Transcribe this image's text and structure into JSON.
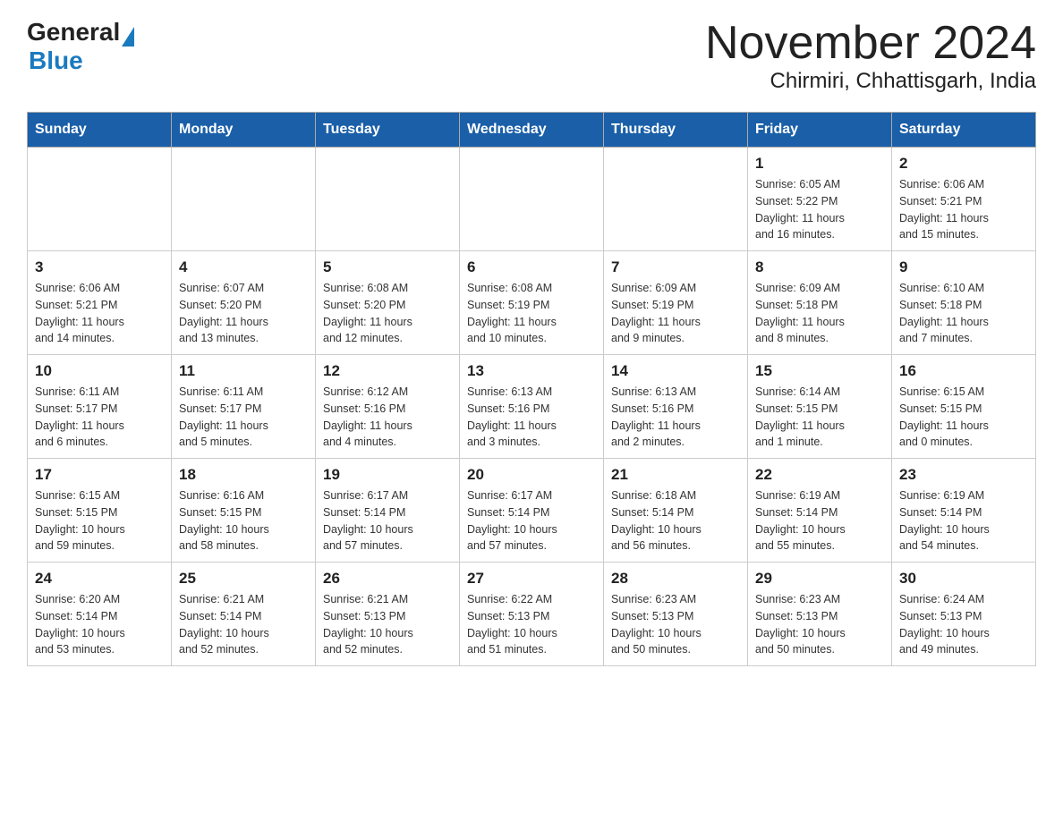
{
  "header": {
    "logo_general": "General",
    "logo_blue": "Blue",
    "month_title": "November 2024",
    "location": "Chirmiri, Chhattisgarh, India"
  },
  "weekdays": [
    "Sunday",
    "Monday",
    "Tuesday",
    "Wednesday",
    "Thursday",
    "Friday",
    "Saturday"
  ],
  "weeks": [
    [
      {
        "day": "",
        "info": ""
      },
      {
        "day": "",
        "info": ""
      },
      {
        "day": "",
        "info": ""
      },
      {
        "day": "",
        "info": ""
      },
      {
        "day": "",
        "info": ""
      },
      {
        "day": "1",
        "info": "Sunrise: 6:05 AM\nSunset: 5:22 PM\nDaylight: 11 hours\nand 16 minutes."
      },
      {
        "day": "2",
        "info": "Sunrise: 6:06 AM\nSunset: 5:21 PM\nDaylight: 11 hours\nand 15 minutes."
      }
    ],
    [
      {
        "day": "3",
        "info": "Sunrise: 6:06 AM\nSunset: 5:21 PM\nDaylight: 11 hours\nand 14 minutes."
      },
      {
        "day": "4",
        "info": "Sunrise: 6:07 AM\nSunset: 5:20 PM\nDaylight: 11 hours\nand 13 minutes."
      },
      {
        "day": "5",
        "info": "Sunrise: 6:08 AM\nSunset: 5:20 PM\nDaylight: 11 hours\nand 12 minutes."
      },
      {
        "day": "6",
        "info": "Sunrise: 6:08 AM\nSunset: 5:19 PM\nDaylight: 11 hours\nand 10 minutes."
      },
      {
        "day": "7",
        "info": "Sunrise: 6:09 AM\nSunset: 5:19 PM\nDaylight: 11 hours\nand 9 minutes."
      },
      {
        "day": "8",
        "info": "Sunrise: 6:09 AM\nSunset: 5:18 PM\nDaylight: 11 hours\nand 8 minutes."
      },
      {
        "day": "9",
        "info": "Sunrise: 6:10 AM\nSunset: 5:18 PM\nDaylight: 11 hours\nand 7 minutes."
      }
    ],
    [
      {
        "day": "10",
        "info": "Sunrise: 6:11 AM\nSunset: 5:17 PM\nDaylight: 11 hours\nand 6 minutes."
      },
      {
        "day": "11",
        "info": "Sunrise: 6:11 AM\nSunset: 5:17 PM\nDaylight: 11 hours\nand 5 minutes."
      },
      {
        "day": "12",
        "info": "Sunrise: 6:12 AM\nSunset: 5:16 PM\nDaylight: 11 hours\nand 4 minutes."
      },
      {
        "day": "13",
        "info": "Sunrise: 6:13 AM\nSunset: 5:16 PM\nDaylight: 11 hours\nand 3 minutes."
      },
      {
        "day": "14",
        "info": "Sunrise: 6:13 AM\nSunset: 5:16 PM\nDaylight: 11 hours\nand 2 minutes."
      },
      {
        "day": "15",
        "info": "Sunrise: 6:14 AM\nSunset: 5:15 PM\nDaylight: 11 hours\nand 1 minute."
      },
      {
        "day": "16",
        "info": "Sunrise: 6:15 AM\nSunset: 5:15 PM\nDaylight: 11 hours\nand 0 minutes."
      }
    ],
    [
      {
        "day": "17",
        "info": "Sunrise: 6:15 AM\nSunset: 5:15 PM\nDaylight: 10 hours\nand 59 minutes."
      },
      {
        "day": "18",
        "info": "Sunrise: 6:16 AM\nSunset: 5:15 PM\nDaylight: 10 hours\nand 58 minutes."
      },
      {
        "day": "19",
        "info": "Sunrise: 6:17 AM\nSunset: 5:14 PM\nDaylight: 10 hours\nand 57 minutes."
      },
      {
        "day": "20",
        "info": "Sunrise: 6:17 AM\nSunset: 5:14 PM\nDaylight: 10 hours\nand 57 minutes."
      },
      {
        "day": "21",
        "info": "Sunrise: 6:18 AM\nSunset: 5:14 PM\nDaylight: 10 hours\nand 56 minutes."
      },
      {
        "day": "22",
        "info": "Sunrise: 6:19 AM\nSunset: 5:14 PM\nDaylight: 10 hours\nand 55 minutes."
      },
      {
        "day": "23",
        "info": "Sunrise: 6:19 AM\nSunset: 5:14 PM\nDaylight: 10 hours\nand 54 minutes."
      }
    ],
    [
      {
        "day": "24",
        "info": "Sunrise: 6:20 AM\nSunset: 5:14 PM\nDaylight: 10 hours\nand 53 minutes."
      },
      {
        "day": "25",
        "info": "Sunrise: 6:21 AM\nSunset: 5:14 PM\nDaylight: 10 hours\nand 52 minutes."
      },
      {
        "day": "26",
        "info": "Sunrise: 6:21 AM\nSunset: 5:13 PM\nDaylight: 10 hours\nand 52 minutes."
      },
      {
        "day": "27",
        "info": "Sunrise: 6:22 AM\nSunset: 5:13 PM\nDaylight: 10 hours\nand 51 minutes."
      },
      {
        "day": "28",
        "info": "Sunrise: 6:23 AM\nSunset: 5:13 PM\nDaylight: 10 hours\nand 50 minutes."
      },
      {
        "day": "29",
        "info": "Sunrise: 6:23 AM\nSunset: 5:13 PM\nDaylight: 10 hours\nand 50 minutes."
      },
      {
        "day": "30",
        "info": "Sunrise: 6:24 AM\nSunset: 5:13 PM\nDaylight: 10 hours\nand 49 minutes."
      }
    ]
  ]
}
